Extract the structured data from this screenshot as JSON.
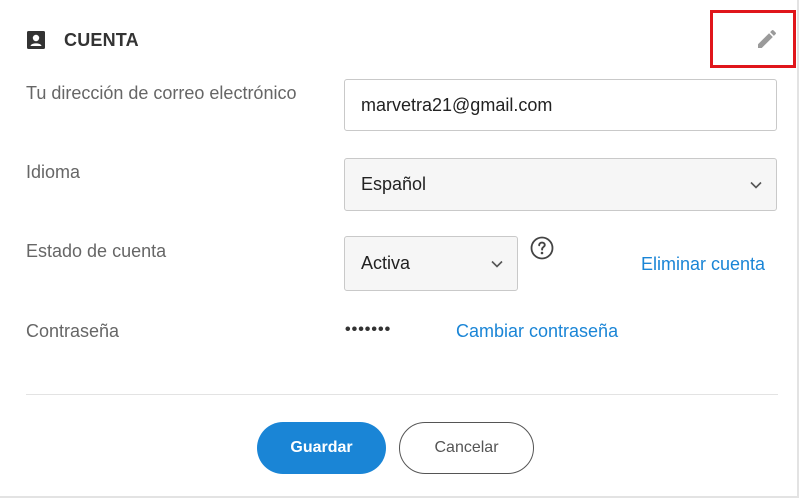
{
  "header": {
    "title": "CUENTA",
    "icon": "contact-card-icon",
    "edit_icon": "pencil-icon",
    "highlight_color": "#e0161b"
  },
  "form": {
    "email": {
      "label": "Tu dirección de correo electrónico",
      "value": "marvetra21@gmail.com"
    },
    "language": {
      "label": "Idioma",
      "value": "Español"
    },
    "account_status": {
      "label": "Estado de cuenta",
      "value": "Activa",
      "help_icon": "help-circle-icon",
      "delete_link": "Eliminar cuenta"
    },
    "password": {
      "label": "Contraseña",
      "masked_value": "•••••••",
      "change_link": "Cambiar contraseña"
    }
  },
  "actions": {
    "save_label": "Guardar",
    "cancel_label": "Cancelar"
  },
  "colors": {
    "accent": "#1a85d6",
    "label": "#666666",
    "border": "#c9c9c9"
  }
}
